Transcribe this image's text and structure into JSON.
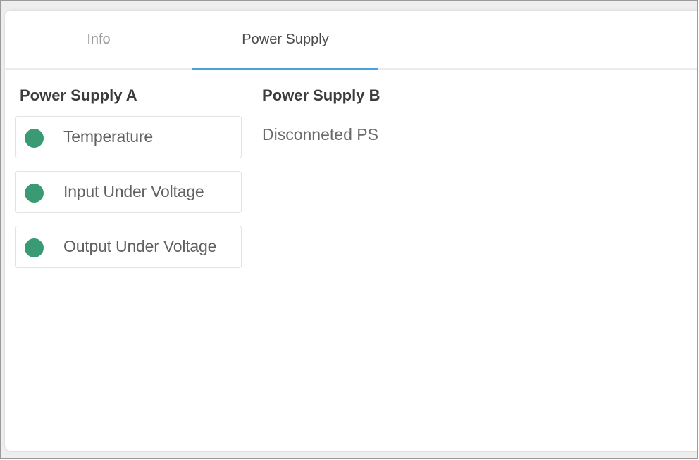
{
  "tabs": {
    "info_label": "Info",
    "power_supply_label": "Power Supply",
    "active": "Power Supply"
  },
  "power_supply_a": {
    "title": "Power Supply A",
    "status_items": [
      {
        "label": "Temperature",
        "status_color": "#3a9a74"
      },
      {
        "label": "Input Under Voltage",
        "status_color": "#3a9a74"
      },
      {
        "label": "Output Under Voltage",
        "status_color": "#3a9a74"
      }
    ]
  },
  "power_supply_b": {
    "title": "Power Supply B",
    "status_text": "Disconneted PS"
  },
  "colors": {
    "accent": "#4aa3df",
    "status_ok": "#3a9a74"
  }
}
